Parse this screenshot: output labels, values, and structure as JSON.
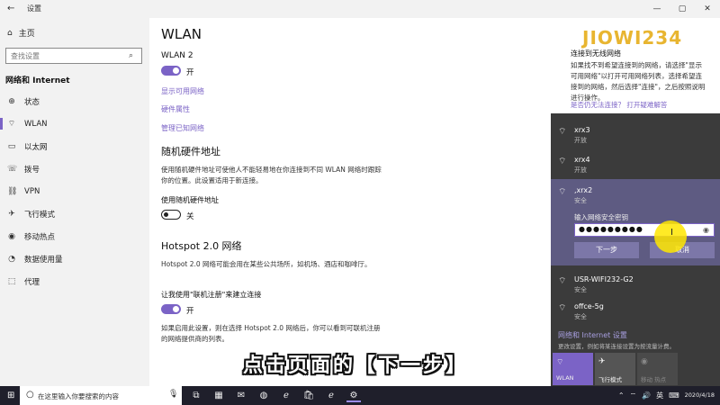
{
  "window": {
    "title": "设置",
    "back_icon": "←",
    "controls": [
      "—",
      "▢",
      "✕"
    ]
  },
  "sidebar": {
    "home_label": "主页",
    "search_placeholder": "查找设置",
    "category": "网络和 Internet",
    "items": [
      {
        "label": "状态",
        "icon": "globe-icon",
        "glyph": "⊕"
      },
      {
        "label": "WLAN",
        "icon": "wifi-icon",
        "glyph": "⌔"
      },
      {
        "label": "以太网",
        "icon": "ethernet-icon",
        "glyph": "▭"
      },
      {
        "label": "拨号",
        "icon": "dialup-icon",
        "glyph": "☏"
      },
      {
        "label": "VPN",
        "icon": "vpn-icon",
        "glyph": "⛓"
      },
      {
        "label": "飞行模式",
        "icon": "airplane-icon",
        "glyph": "✈"
      },
      {
        "label": "移动热点",
        "icon": "hotspot-icon",
        "glyph": "◉"
      },
      {
        "label": "数据使用量",
        "icon": "data-usage-icon",
        "glyph": "◔"
      },
      {
        "label": "代理",
        "icon": "proxy-icon",
        "glyph": "⬚"
      }
    ],
    "active_index": 1
  },
  "main": {
    "title": "WLAN",
    "wlan2_label": "WLAN 2",
    "wlan2_state": "开",
    "links": [
      "显示可用网络",
      "硬件属性",
      "管理已知网络"
    ],
    "random_hw_heading": "随机硬件地址",
    "random_hw_desc": "使用随机硬件地址可使他人不能轻易地在你连接到不同 WLAN 网络时跟踪你的位置。此设置适用于新连接。",
    "random_hw_toggle_label": "使用随机硬件地址",
    "random_hw_state": "关",
    "hotspot_heading": "Hotspot 2.0 网络",
    "hotspot_desc": "Hotspot 2.0 网络可能会用在某些公共场所，如机场、酒店和咖啡厅。",
    "hotspot_toggle_label": "让我使用\"联机注册\"来建立连接",
    "hotspot_state": "开",
    "hotspot_desc2": "如果启用此设置，则在选择 Hotspot 2.0 网络后，你可以看到可联机注册的网络提供商的列表。"
  },
  "tips": {
    "logo": "JIOWI234",
    "title": "连接到无线网络",
    "body": "如果找不到希望连接到的网络，请选择\"显示可用网络\"以打开可用网络列表，选择希望连接到的网络，然后选择\"连接\"，之后按照说明进行操作。",
    "link1": "是否仍无法连接？",
    "link2": "打开疑难解答"
  },
  "flyout": {
    "networks": [
      {
        "name": "xrx3",
        "status": "开放"
      },
      {
        "name": "xrx4",
        "status": "开放"
      }
    ],
    "expanded": {
      "name": ",xrx2",
      "status": "安全",
      "pw_label": "输入网络安全密钥",
      "pw_value": "●●●●●●●●●",
      "next_label": "下一步",
      "cancel_label": "取消"
    },
    "networks_after": [
      {
        "name": "USR-WIFI232-G2",
        "status": "安全"
      },
      {
        "name": "offce-5g",
        "status": "安全"
      }
    ],
    "settings_link": "网络和 Internet 设置",
    "settings_sub": "更改设置，例如将某连接设置为按流量计费。",
    "quick": [
      {
        "label": "WLAN",
        "glyph": "⌔"
      },
      {
        "label": "飞行模式",
        "glyph": "✈"
      },
      {
        "label": "移动\n热点",
        "glyph": "◉"
      }
    ]
  },
  "subtitle": "点击页面的【下一步】",
  "taskbar": {
    "search_placeholder": "在这里输入你要搜索的内容",
    "apps": [
      "⧉",
      "▦",
      "✉",
      "◍",
      "ℯ",
      "🛍",
      "ℯ",
      "⚙"
    ],
    "tray_icons": [
      "⌃",
      "⌔",
      "🔊",
      "英",
      "⌨"
    ],
    "date": "2020/4/18"
  }
}
